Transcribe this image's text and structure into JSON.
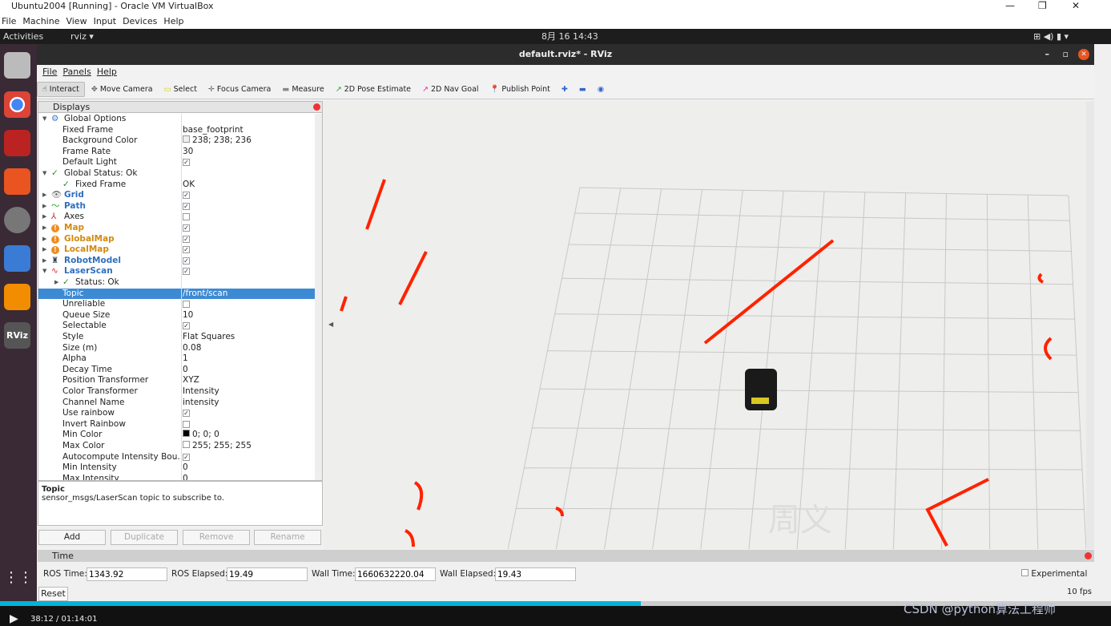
{
  "vbox": {
    "title": "Ubuntu2004 [Running] - Oracle VM VirtualBox",
    "menu": [
      "File",
      "Machine",
      "View",
      "Input",
      "Devices",
      "Help"
    ]
  },
  "ubuntu": {
    "activities": "Activities",
    "app": "rviz ▾",
    "clock": "8月 16  14:43"
  },
  "rviz": {
    "title": "default.rviz* - RViz",
    "menu": [
      "File",
      "Panels",
      "Help"
    ],
    "toolbar": [
      "Interact",
      "Move Camera",
      "Select",
      "Focus Camera",
      "Measure",
      "2D Pose Estimate",
      "2D Nav Goal",
      "Publish Point"
    ],
    "displays_title": "Displays",
    "tree": [
      {
        "label": "Global Options",
        "indent": 0,
        "exp": "open",
        "icon": "gear-icon",
        "value": ""
      },
      {
        "label": "Fixed Frame",
        "indent": 1,
        "value": "base_footprint"
      },
      {
        "label": "Background Color",
        "indent": 1,
        "value": "238; 238; 236",
        "swatch": "#eeeeec"
      },
      {
        "label": "Frame Rate",
        "indent": 1,
        "value": "30"
      },
      {
        "label": "Default Light",
        "indent": 1,
        "check": true
      },
      {
        "label": "Global Status: Ok",
        "indent": 0,
        "exp": "open",
        "icon": "check-icon"
      },
      {
        "label": "Fixed Frame",
        "indent": 2,
        "icon": "check-icon",
        "value": "OK"
      },
      {
        "label": "Grid",
        "indent": 0,
        "exp": "closed",
        "icon": "grid-icon",
        "color": "#2f6fc0",
        "check": true
      },
      {
        "label": "Path",
        "indent": 0,
        "exp": "closed",
        "icon": "path-icon",
        "color": "#2f6fc0",
        "check": true
      },
      {
        "label": "Axes",
        "indent": 0,
        "exp": "closed",
        "icon": "axes-icon",
        "check": false
      },
      {
        "label": "Map",
        "indent": 0,
        "exp": "closed",
        "icon": "warning-icon",
        "color": "#d08a10",
        "check": true
      },
      {
        "label": "GlobalMap",
        "indent": 0,
        "exp": "closed",
        "icon": "warning-icon",
        "color": "#d08a10",
        "check": true
      },
      {
        "label": "LocalMap",
        "indent": 0,
        "exp": "closed",
        "icon": "warning-icon",
        "color": "#d08a10",
        "check": true
      },
      {
        "label": "RobotModel",
        "indent": 0,
        "exp": "closed",
        "icon": "robot-icon",
        "color": "#2f6fc0",
        "check": true
      },
      {
        "label": "LaserScan",
        "indent": 0,
        "exp": "open",
        "icon": "laser-icon",
        "color": "#2f6fc0",
        "check": true
      },
      {
        "label": "Status: Ok",
        "indent": 2,
        "exp": "closed",
        "icon": "check-icon"
      },
      {
        "label": "Topic",
        "indent": 1,
        "value": "/front/scan",
        "selected": true
      },
      {
        "label": "Unreliable",
        "indent": 1,
        "check": false
      },
      {
        "label": "Queue Size",
        "indent": 1,
        "value": "10"
      },
      {
        "label": "Selectable",
        "indent": 1,
        "check": true
      },
      {
        "label": "Style",
        "indent": 1,
        "value": "Flat Squares"
      },
      {
        "label": "Size (m)",
        "indent": 1,
        "value": "0.08"
      },
      {
        "label": "Alpha",
        "indent": 1,
        "value": "1"
      },
      {
        "label": "Decay Time",
        "indent": 1,
        "value": "0"
      },
      {
        "label": "Position Transformer",
        "indent": 1,
        "value": "XYZ"
      },
      {
        "label": "Color Transformer",
        "indent": 1,
        "value": "Intensity"
      },
      {
        "label": "Channel Name",
        "indent": 1,
        "value": "intensity"
      },
      {
        "label": "Use rainbow",
        "indent": 1,
        "check": true
      },
      {
        "label": "Invert Rainbow",
        "indent": 1,
        "check": false
      },
      {
        "label": "Min Color",
        "indent": 1,
        "value": "0; 0; 0",
        "swatch": "#000000"
      },
      {
        "label": "Max Color",
        "indent": 1,
        "value": "255; 255; 255",
        "swatch": "#ffffff"
      },
      {
        "label": "Autocompute Intensity Bou...",
        "indent": 1,
        "check": true
      },
      {
        "label": "Min Intensity",
        "indent": 1,
        "value": "0"
      },
      {
        "label": "Max Intensity",
        "indent": 1,
        "value": "0"
      }
    ],
    "desc": {
      "title": "Topic",
      "text": "sensor_msgs/LaserScan topic to subscribe to."
    },
    "buttons": [
      "Add",
      "Duplicate",
      "Remove",
      "Rename"
    ],
    "watermark": "周义",
    "time": {
      "title": "Time",
      "ros_time_label": "ROS Time:",
      "ros_time": "1343.92",
      "ros_elapsed_label": "ROS Elapsed:",
      "ros_elapsed": "19.49",
      "wall_time_label": "Wall Time:",
      "wall_time": "1660632220.04",
      "wall_elapsed_label": "Wall Elapsed:",
      "wall_elapsed": "19.43",
      "experimental": "Experimental",
      "reset": "Reset",
      "fps": "10 fps"
    },
    "laser_color": "#ff2200"
  },
  "video": {
    "time": "38:12 / 01:14:01",
    "progress": 0.577,
    "watermark": "CSDN @python算法工程师"
  }
}
